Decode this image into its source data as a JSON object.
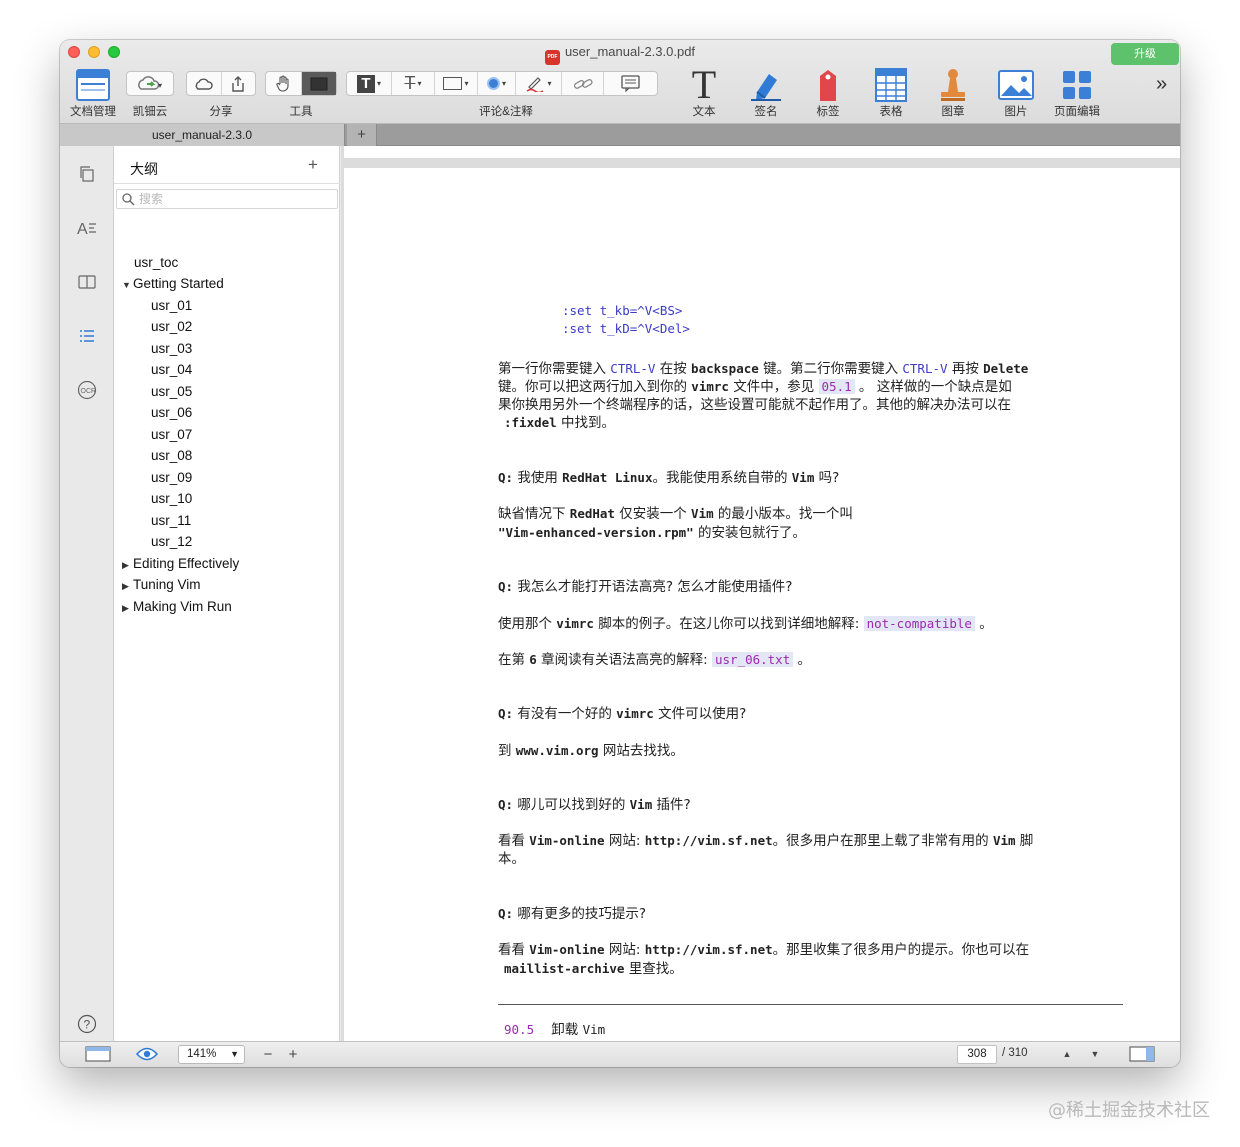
{
  "window": {
    "title": "user_manual-2.3.0.pdf",
    "pdf_badge": "PDF",
    "upgrade_label": "升级"
  },
  "toolbar": {
    "doc_manage": "文档管理",
    "cloud": "凯钿云",
    "share": "分享",
    "tools": "工具",
    "annotate": "评论&注释",
    "text": "文本",
    "sign": "签名",
    "tag": "标签",
    "table": "表格",
    "stamp": "图章",
    "image": "图片",
    "page_edit": "页面编辑",
    "more": "»",
    "text_glyph": "T"
  },
  "tabs": {
    "active": "user_manual-2.3.0",
    "add": "+"
  },
  "outline": {
    "title": "大纲",
    "add": "+",
    "search_placeholder": "搜索",
    "items": {
      "toc": "usr_toc",
      "getting_started": "Getting Started",
      "u01": "usr_01",
      "u02": "usr_02",
      "u03": "usr_03",
      "u04": "usr_04",
      "u05": "usr_05",
      "u06": "usr_06",
      "u07": "usr_07",
      "u08": "usr_08",
      "u09": "usr_09",
      "u10": "usr_10",
      "u11": "usr_11",
      "u12": "usr_12",
      "editing": "Editing Effectively",
      "tuning": "Tuning Vim",
      "making": "Making Vim Run"
    }
  },
  "doc": {
    "code1": ":set t_kb=^V<BS>",
    "code2": ":set t_kD=^V<Del>",
    "p1a_1": "第一行你需要键入 ",
    "p1a_ctrl": "CTRL-V",
    "p1a_2": " 在按 ",
    "p1a_bs": "backspace",
    "p1a_3": " 键。第二行你需要键入 ",
    "p1a_ctrl2": "CTRL-V",
    "p1a_4": " 再按 ",
    "p1a_del": "Delete",
    "p1b_1": "键。你可以把这两行加入到你的 ",
    "p1b_vimrc": "vimrc",
    "p1b_2": " 文件中，参见 ",
    "p1b_ref": "05.1",
    "p1b_3": " 。 这样做的一个缺点是如",
    "p1c": "果你换用另外一个终端程序的话，这些设置可能就不起作用了。其他的解决办法可以在",
    "p1d_cmd": ":fixdel",
    "p1d_2": "  中找到。",
    "q1_q": "Q:",
    "q1_1": " 我使用 ",
    "q1_rh": "RedHat Linux",
    "q1_2": "。我能使用系统自带的 ",
    "q1_vim": "Vim",
    "q1_3": " 吗?",
    "a1a_1": "缺省情况下 ",
    "a1a_rh": "RedHat",
    "a1a_2": " 仅安装一个 ",
    "a1a_vim": "Vim",
    "a1a_3": " 的最小版本。找一个叫",
    "a1b_pkg": "\"Vim-enhanced-version.rpm\"",
    "a1b_2": "  的安装包就行了。",
    "q2_q": "Q:",
    "q2_1": " 我怎么才能打开语法高亮? 怎么才能使用插件?",
    "a2_1": "使用那个 ",
    "a2_vimrc": "vimrc",
    "a2_2": " 脚本的例子。在这儿你可以找到详细地解释:  ",
    "a2_link": "not-compatible",
    "a2_3": " 。",
    "a3_1": "在第 ",
    "a3_num": "6",
    "a3_2": " 章阅读有关语法高亮的解释:  ",
    "a3_link": "usr_06.txt",
    "a3_3": " 。",
    "q3_q": "Q:",
    "q3_1": " 有没有一个好的 ",
    "q3_vimrc": "vimrc",
    "q3_2": " 文件可以使用?",
    "a4_1": "到 ",
    "a4_site": "www.vim.org",
    "a4_2": " 网站去找找。",
    "q4_q": "Q:",
    "q4_1": " 哪儿可以找到好的 ",
    "q4_vim": "Vim",
    "q4_2": " 插件?",
    "a5a_1": "看看 ",
    "a5a_vo": "Vim-online",
    "a5a_2": " 网站: ",
    "a5a_url": "http://vim.sf.net",
    "a5a_3": "。很多用户在那里上载了非常有用的 ",
    "a5a_vim": "Vim",
    "a5a_4": " 脚",
    "a5b": "本。",
    "q5_q": "Q:",
    "q5_1": " 哪有更多的技巧提示?",
    "a6a_1": "看看 ",
    "a6a_vo": "Vim-online",
    "a6a_2": " 网站: ",
    "a6a_url": "http://vim.sf.net",
    "a6a_3": "。那里收集了很多用户的提示。你也可以在",
    "a6b_arch": "maillist-archive",
    "a6b_2": "  里查找。",
    "footer_num": "90.5",
    "footer_title": "卸载",
    "footer_vim": "Vim"
  },
  "statusbar": {
    "zoom": "141%",
    "minus": "−",
    "plus": "+",
    "page_current": "308",
    "page_total": "/ 310",
    "up": "▲",
    "down": "▼"
  },
  "watermark": "@稀土掘金技术社区"
}
